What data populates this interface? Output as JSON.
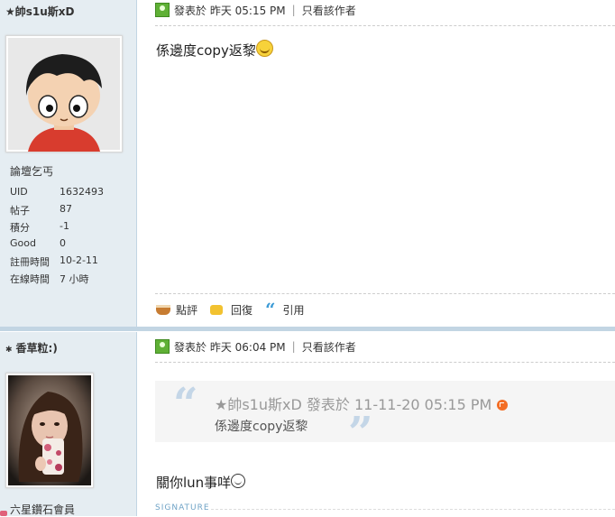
{
  "post1": {
    "author": "★帥s1u斯xD",
    "rank": "論壇乞丐",
    "stats": [
      {
        "label": "UID",
        "value": "1632493"
      },
      {
        "label": "帖子",
        "value": "87"
      },
      {
        "label": "積分",
        "value": "-1"
      },
      {
        "label": "Good",
        "value": "0"
      },
      {
        "label": "註冊時間",
        "value": "10-2-11"
      },
      {
        "label": "在線時間",
        "value": "7 小時"
      }
    ],
    "posted_prefix": "發表於",
    "posted_time": "昨天 05:15 PM",
    "only_author": "只看該作者",
    "content": "係邊度copy返黎",
    "actions": {
      "rate": "點評",
      "reply": "回復",
      "quote": "引用"
    }
  },
  "post2": {
    "author": "香草粒:)",
    "rank": "六星鑽石會員",
    "posted_prefix": "發表於",
    "posted_time": "昨天 06:04 PM",
    "only_author": "只看該作者",
    "quote_header": "★帥s1u斯xD 發表於 11-11-20 05:15 PM",
    "quote_body": "係邊度copy返黎",
    "content": "關你lun事咩",
    "signature_label": "SIGNATURE"
  },
  "colors": {
    "sidebar_bg": "#e5edf2",
    "separator": "#c2d5e3",
    "online_icon": "#5fb035",
    "quote_mark": "#c4d6e7"
  }
}
